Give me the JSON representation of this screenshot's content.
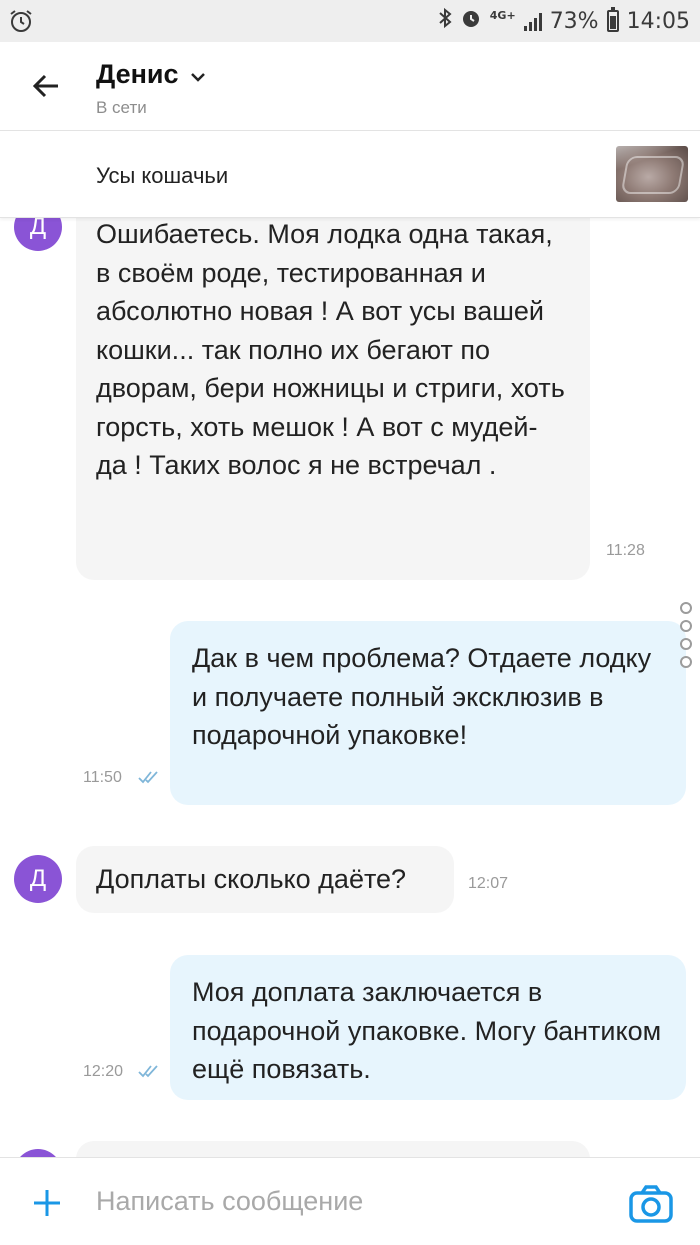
{
  "status_bar": {
    "network": "4G+",
    "battery": "73%",
    "time": "14:05",
    "battery_level": 0.73,
    "icons": [
      "alarm-icon",
      "bluetooth-icon",
      "alarm-clock-icon",
      "signal-icon",
      "battery-icon"
    ]
  },
  "header": {
    "contact_name": "Денис",
    "status": "В сети",
    "icons": [
      "back-arrow-icon",
      "chevron-down-icon"
    ]
  },
  "product": {
    "title": "Усы кошачьи"
  },
  "messages": [
    {
      "direction": "in",
      "avatar": "Д",
      "text": "Ошибаетесь. Моя лодка одна такая, в своём роде, тестированная и абсолютно новая ! А вот усы вашей кошки... так полно их бегают по дворам, бери ножницы и стриги, хоть горсть, хоть мешок ! А вот с мудей- да ! Таких волос я не встречал .",
      "time": "11:28"
    },
    {
      "direction": "out",
      "text": "Дак в чем проблема? Отдаете лодку и получаете полный эксклюзив в подарочной упаковке!",
      "time": "11:50",
      "read": true
    },
    {
      "direction": "in",
      "avatar": "Д",
      "text": "Доплаты сколько даёте?",
      "time": "12:07"
    },
    {
      "direction": "out",
      "text": "Моя доплата заключается в подарочной упаковке. Могу бантиком ещё повязать.",
      "time": "12:20",
      "read": true
    }
  ],
  "composer": {
    "placeholder": "Написать сообщение",
    "icons": [
      "plus-icon",
      "camera-icon"
    ]
  },
  "colors": {
    "accent": "#1a97e6",
    "avatar": "#8a54d6",
    "incoming_bubble": "#f5f5f5",
    "outgoing_bubble": "#e7f5fd"
  }
}
